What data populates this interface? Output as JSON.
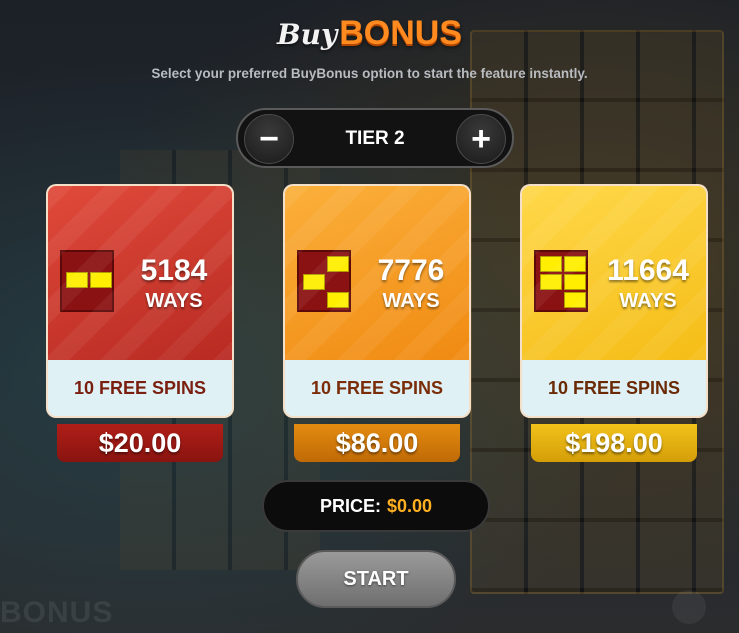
{
  "title": {
    "buy": "Buy",
    "bonus": "BONUS"
  },
  "subtitle": "Select your preferred BuyBonus option to start the feature instantly.",
  "tier": {
    "label": "TIER 2",
    "minus": "−",
    "plus": "+"
  },
  "cards": [
    {
      "ways": "5184",
      "ways_label": "WAYS",
      "spins": "10 FREE SPINS",
      "price": "$20.00",
      "color": "#c9352b"
    },
    {
      "ways": "7776",
      "ways_label": "WAYS",
      "spins": "10 FREE SPINS",
      "price": "$86.00",
      "color": "#f59a1e"
    },
    {
      "ways": "11664",
      "ways_label": "WAYS",
      "spins": "10 FREE SPINS",
      "price": "$198.00",
      "color": "#fbc92a"
    }
  ],
  "price": {
    "label": "PRICE:",
    "value": "$0.00"
  },
  "start_label": "START",
  "background": {
    "watermark": "BONUS"
  },
  "colors": {
    "accent": "#ff8a1f",
    "price_value": "#ffb020",
    "ways_icon": "#8b1212",
    "ways_cell": "#ffee00"
  }
}
